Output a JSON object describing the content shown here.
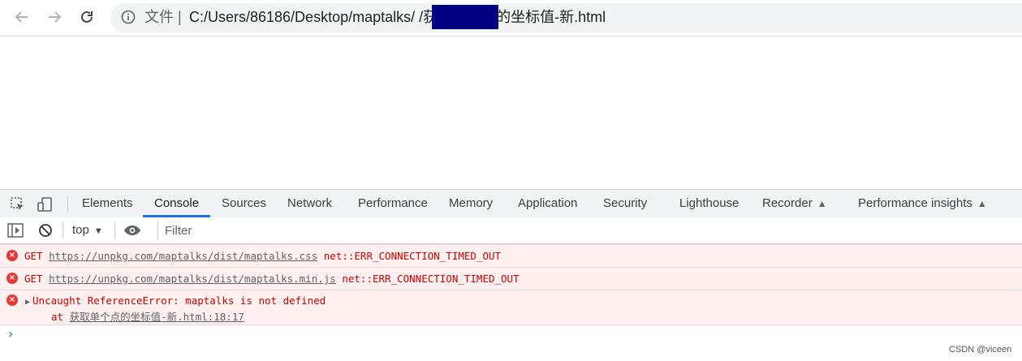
{
  "browser": {
    "back_icon": "arrow-left-icon",
    "forward_icon": "arrow-right-icon",
    "reload_icon": "reload-icon",
    "info_icon": "info-circle-icon",
    "scheme_label": "文件 |",
    "url": "C:/Users/86186/Desktop/maptalks/                  /获取单个点的坐标值-新.html"
  },
  "devtools": {
    "inspect_icon": "inspect-element-icon",
    "device_icon": "device-toggle-icon",
    "tabs": [
      {
        "label": "Elements"
      },
      {
        "label": "Console"
      },
      {
        "label": "Sources"
      },
      {
        "label": "Network"
      },
      {
        "label": "Performance"
      },
      {
        "label": "Memory"
      },
      {
        "label": "Application"
      },
      {
        "label": "Security"
      },
      {
        "label": "Lighthouse"
      },
      {
        "label": "Recorder"
      },
      {
        "label": "Performance insights"
      }
    ],
    "active_tab": "Console"
  },
  "console": {
    "sidebar_icon": "sidebar-toggle-icon",
    "clear_icon": "clear-console-icon",
    "context": "top",
    "eye_icon": "eye-icon",
    "filter_placeholder": "Filter",
    "messages": [
      {
        "method": "GET",
        "url": "https://unpkg.com/maptalks/dist/maptalks.css",
        "error": "net::ERR_CONNECTION_TIMED_OUT"
      },
      {
        "method": "GET",
        "url": "https://unpkg.com/maptalks/dist/maptalks.min.js",
        "error": "net::ERR_CONNECTION_TIMED_OUT"
      },
      {
        "text": "Uncaught ReferenceError: maptalks is not defined",
        "at_prefix": "at",
        "location": "获取单个点的坐标值-新.html:18:17"
      }
    ],
    "prompt": "›"
  },
  "watermark": "CSDN @viceen"
}
